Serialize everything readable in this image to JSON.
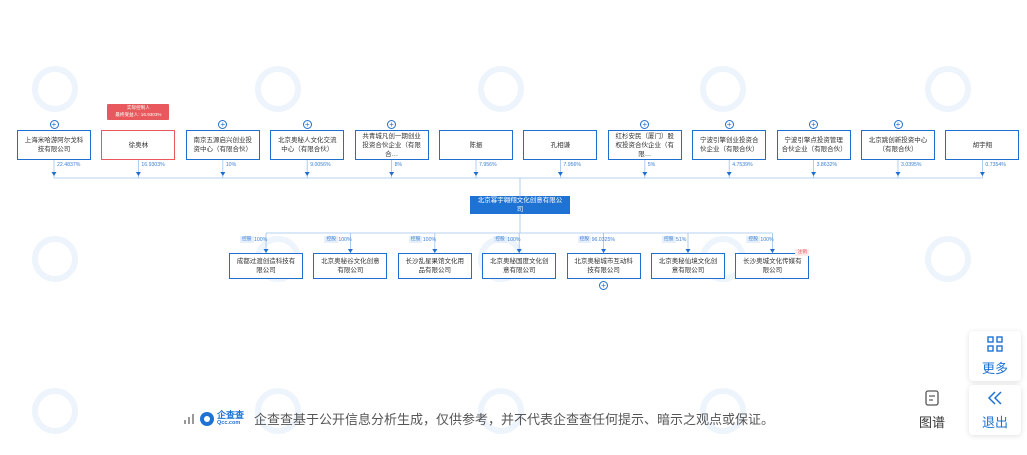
{
  "shareholders": [
    {
      "name": "上海米哈游阿尔戈科技有限公司",
      "pct": "22.4837%",
      "expand": true,
      "red": false
    },
    {
      "name": "徐奥林",
      "pct": "16.9303%",
      "expand": false,
      "red": true
    },
    {
      "name": "南京五源启兴创业投资中心（有限合伙）",
      "pct": "10%",
      "expand": true,
      "red": false
    },
    {
      "name": "北京奥秘人文化交流中心（有限合伙）",
      "pct": "9.0056%",
      "expand": true,
      "red": false
    },
    {
      "name": "共青城凡创一期创业投资合伙企业（有限合…",
      "pct": "8%",
      "expand": true,
      "red": false
    },
    {
      "name": "陈振",
      "pct": "7.956%",
      "expand": false,
      "red": false
    },
    {
      "name": "孔相谦",
      "pct": "7.956%",
      "expand": false,
      "red": false
    },
    {
      "name": "红杉安民（厦门）股权投资合伙企业（有限…",
      "pct": "5%",
      "expand": true,
      "red": false
    },
    {
      "name": "宁波引擎创业投资合伙企业（有限合伙）",
      "pct": "4.7539%",
      "expand": true,
      "red": false
    },
    {
      "name": "宁波引擎点投资管理合伙企业（有限合伙）",
      "pct": "3.8632%",
      "expand": true,
      "red": false
    },
    {
      "name": "北京跳创新投资中心（有限合伙）",
      "pct": "3.0395%",
      "expand": true,
      "red": false
    },
    {
      "name": "胡宇翔",
      "pct": "0.7354%",
      "expand": false,
      "red": false
    }
  ],
  "controller_tip": {
    "line1": "实际控制人",
    "line2": "最终受益人: 16.9303%"
  },
  "main_company": "北京幂宇翱翔文化创意有限公司",
  "subsidiaries": [
    {
      "name": "成都过渡创造科技有限公司",
      "tag": "控股",
      "pct": "100%",
      "expand": false,
      "badge": ""
    },
    {
      "name": "北京奥秘谷文化创意有限公司",
      "tag": "控股",
      "pct": "100%",
      "expand": false,
      "badge": ""
    },
    {
      "name": "长沙乱星果馆文化用品有限公司",
      "tag": "控股",
      "pct": "100%",
      "expand": false,
      "badge": ""
    },
    {
      "name": "北京奥秘国度文化创意有限公司",
      "tag": "控股",
      "pct": "100%",
      "expand": false,
      "badge": ""
    },
    {
      "name": "北京奥秘城市互动科技有限公司",
      "tag": "控股",
      "pct": "96.0325%",
      "expand": true,
      "badge": ""
    },
    {
      "name": "北京奥秘仙境文化创意有限公司",
      "tag": "控股",
      "pct": "51%",
      "expand": false,
      "badge": ""
    },
    {
      "name": "长沙奥城文化传媒有限公司",
      "tag": "控股",
      "pct": "100%",
      "expand": false,
      "badge": "注销"
    }
  ],
  "side": {
    "more": "更多",
    "back": "退出",
    "map": "图谱"
  },
  "footer": {
    "brand_top": "企查查",
    "brand_bottom": "Qcc.com",
    "text": "企查查基于公开信息分析生成，仅供参考，并不代表企查查任何提示、暗示之观点或保证。"
  },
  "colors": {
    "accent": "#1e72d4",
    "line": "#1f6fd1",
    "red": "#e8585c"
  }
}
